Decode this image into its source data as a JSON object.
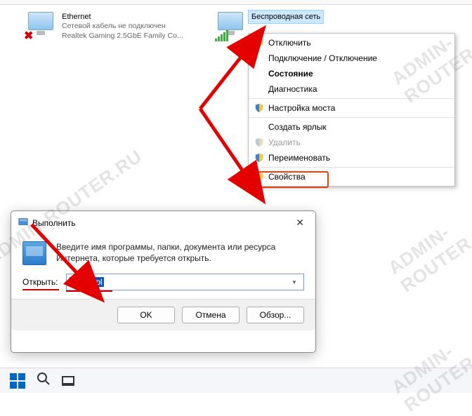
{
  "connections": [
    {
      "name": "Ethernet",
      "line2": "Сетевой кабель не подключен",
      "line3": "Realtek Gaming 2.5GbE Family Co...",
      "status_icon": "red-x"
    },
    {
      "name": "Беспроводная сеть",
      "line2": "",
      "line3": "",
      "status_icon": "wifi"
    }
  ],
  "context_menu": {
    "items": [
      {
        "label": "Отключить",
        "shield": true
      },
      {
        "label": "Подключение / Отключение"
      },
      {
        "label": "Состояние",
        "bold": true
      },
      {
        "label": "Диагностика"
      },
      {
        "label": "Настройка моста",
        "shield": true,
        "sep": true
      },
      {
        "label": "Создать ярлык",
        "sep": true
      },
      {
        "label": "Удалить",
        "shield": true,
        "disabled": true
      },
      {
        "label": "Переименовать",
        "shield": true
      },
      {
        "label": "Свойства",
        "shield": true,
        "sep": true
      }
    ]
  },
  "run": {
    "title": "Выполнить",
    "description": "Введите имя программы, папки, документа или ресурса Интернета, которые требуется открыть.",
    "open_label": "Открыть:",
    "value": "ncpa.cpl",
    "ok": "OK",
    "cancel": "Отмена",
    "browse": "Обзор..."
  },
  "watermark": "ADMIN-ROUTER.RU"
}
